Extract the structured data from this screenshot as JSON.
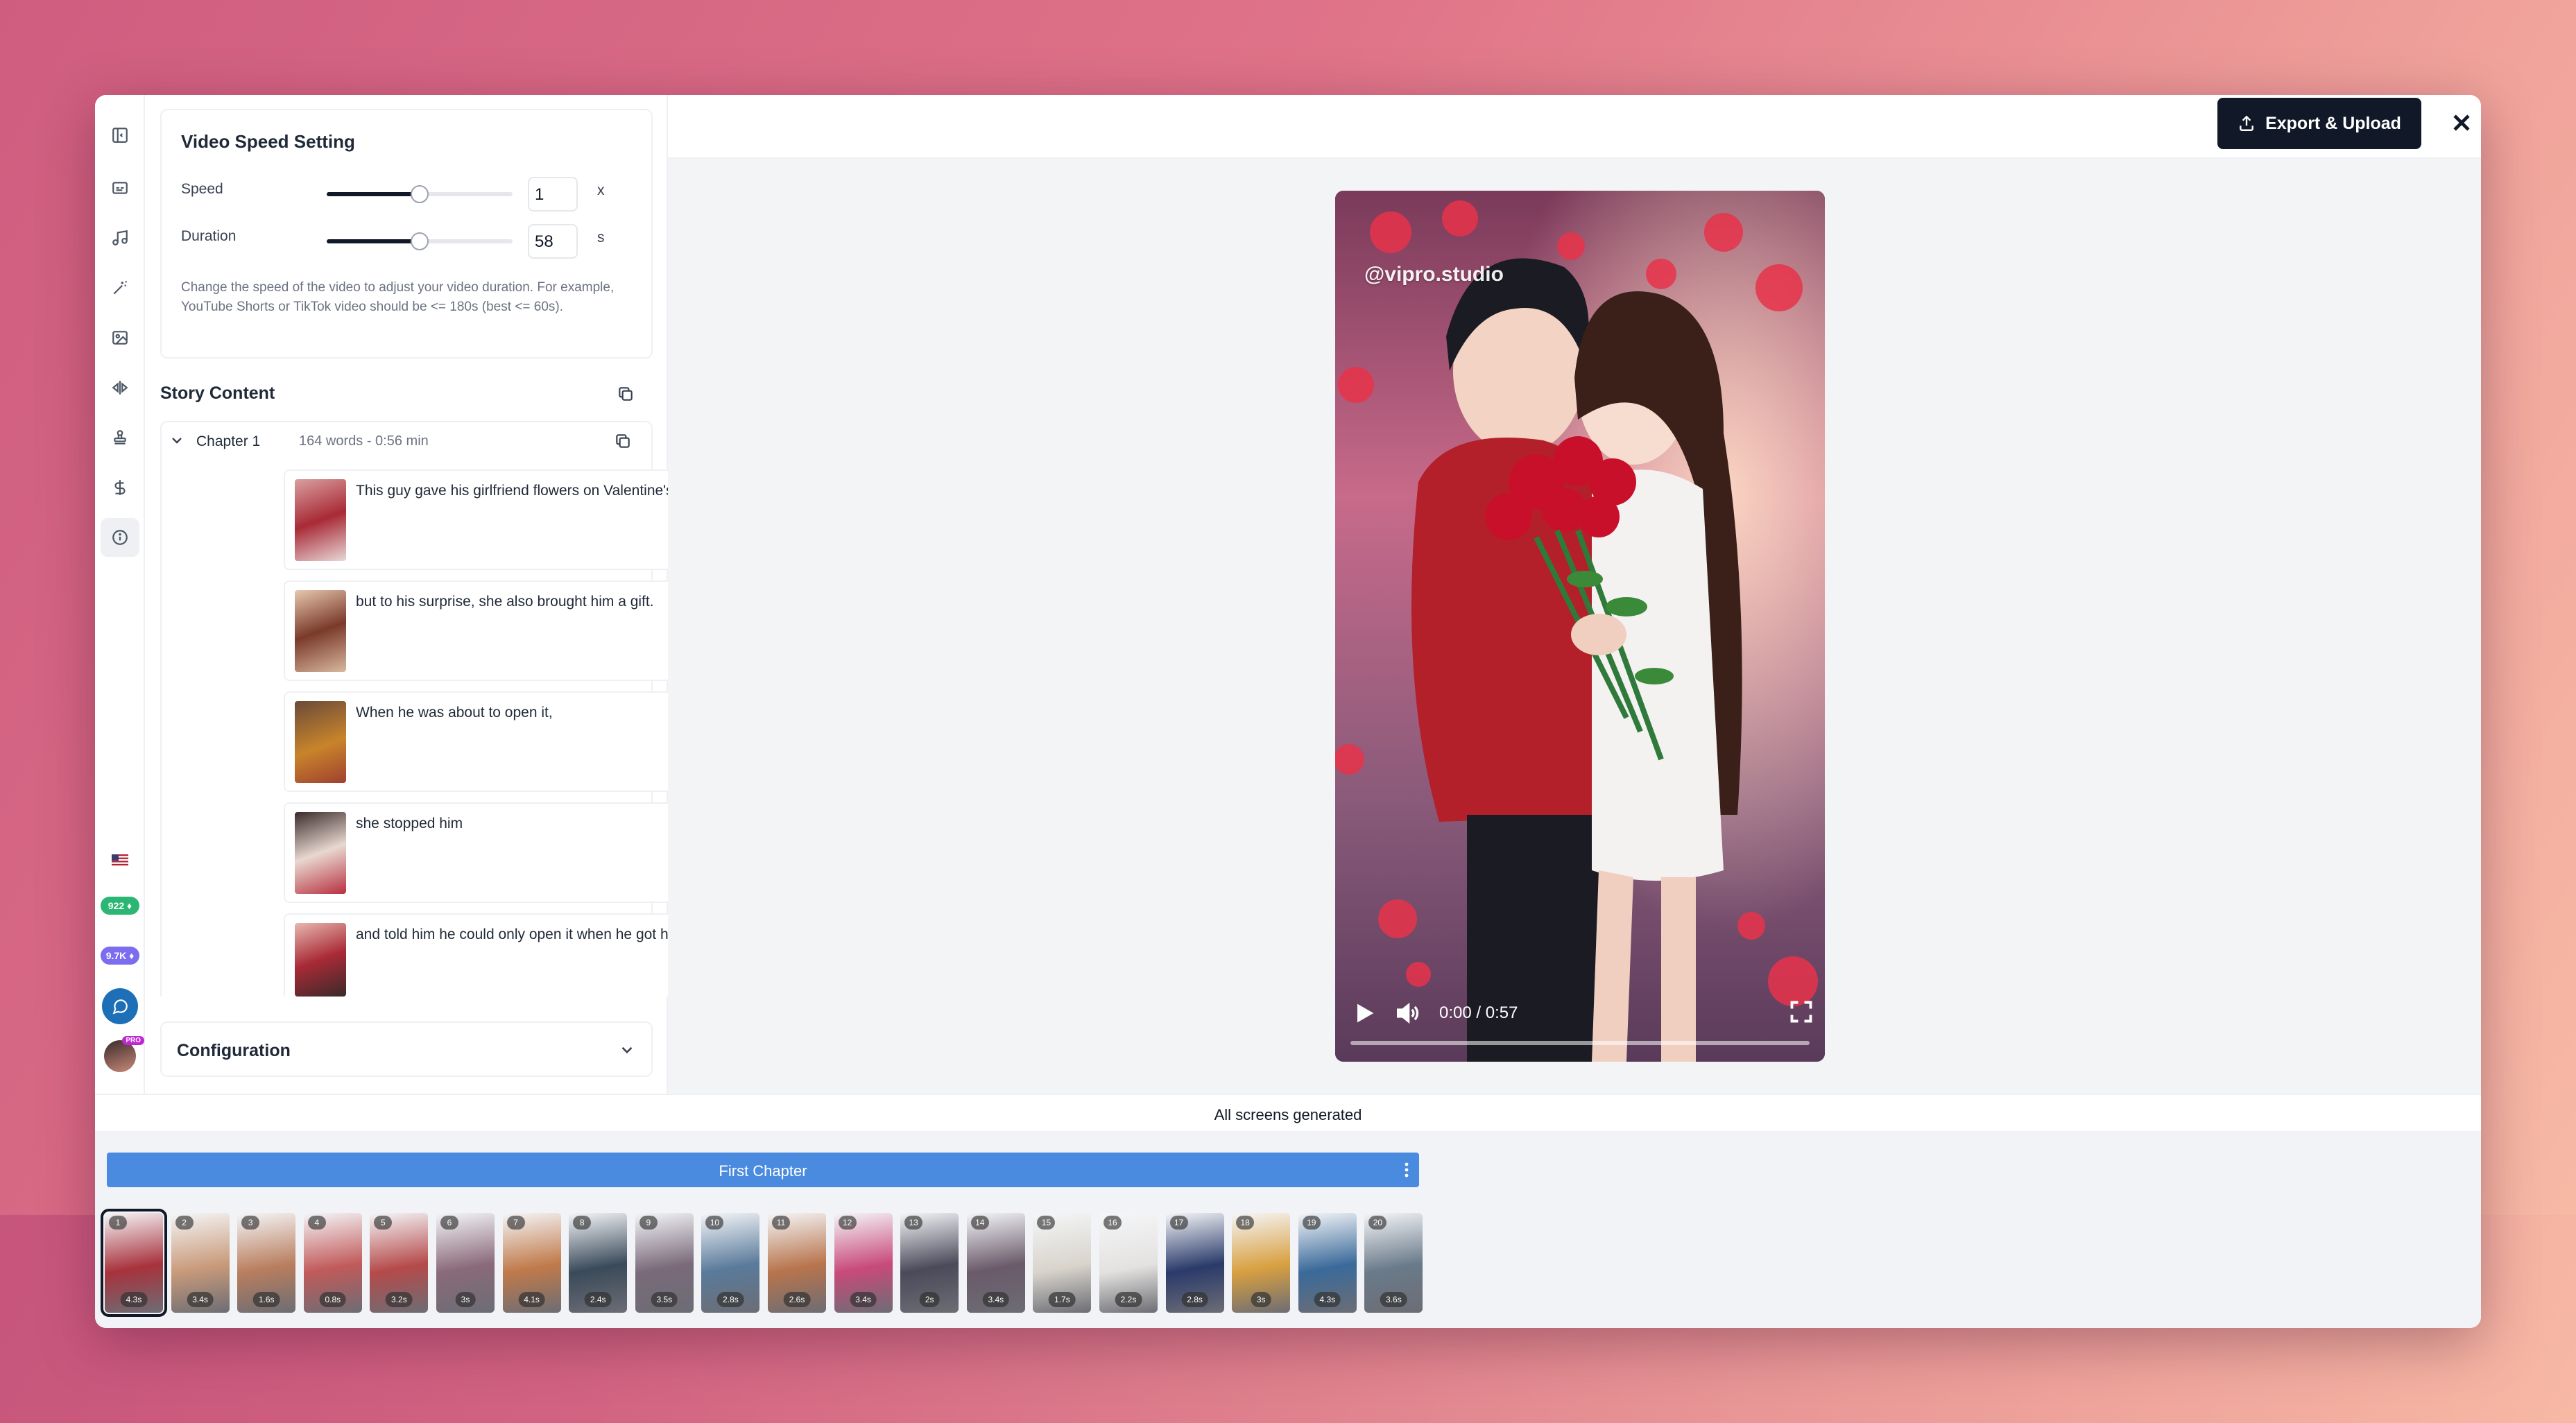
{
  "speed_setting": {
    "title": "Video Speed Setting",
    "speed_label": "Speed",
    "speed_value": "1",
    "speed_unit": "x",
    "speed_slider_fraction": 0.5,
    "duration_label": "Duration",
    "duration_value": "58",
    "duration_unit": "s",
    "duration_slider_fraction": 0.5,
    "help_text": "Change the speed of the video to adjust your video duration. For example, YouTube Shorts or TikTok video should be <= 180s (best <= 60s)."
  },
  "story": {
    "title": "Story Content",
    "chapter_name": "Chapter 1",
    "chapter_meta": "164 words - 0:56 min",
    "scenes": [
      "This guy gave his girlfriend flowers on Valentine's Day,",
      "but to his surprise, she also brought him a gift.",
      "When he was about to open it,",
      "she stopped him",
      "and told him he could only open it when he got home."
    ]
  },
  "configuration_label": "Configuration",
  "header": {
    "export_label": "Export & Upload"
  },
  "video": {
    "watermark": "@vipro.studio",
    "time": "0:00 / 0:57"
  },
  "status_text": "All screens generated",
  "timeline": {
    "chapter_label": "First Chapter",
    "frames": [
      {
        "n": "1",
        "d": "4.3s",
        "c": "#a8323c"
      },
      {
        "n": "2",
        "d": "3.4s",
        "c": "#c99a7a"
      },
      {
        "n": "3",
        "d": "1.6s",
        "c": "#b97e5e"
      },
      {
        "n": "4",
        "d": "0.8s",
        "c": "#c15a5a"
      },
      {
        "n": "5",
        "d": "3.2s",
        "c": "#b54a4a"
      },
      {
        "n": "6",
        "d": "3s",
        "c": "#8a6a7a"
      },
      {
        "n": "7",
        "d": "4.1s",
        "c": "#c07a4a"
      },
      {
        "n": "8",
        "d": "2.4s",
        "c": "#3a4a5a"
      },
      {
        "n": "9",
        "d": "3.5s",
        "c": "#7a6a7a"
      },
      {
        "n": "10",
        "d": "2.8s",
        "c": "#5a7a9a"
      },
      {
        "n": "11",
        "d": "2.6s",
        "c": "#b8744c"
      },
      {
        "n": "12",
        "d": "3.4s",
        "c": "#c84a7a"
      },
      {
        "n": "13",
        "d": "2s",
        "c": "#4a4a5a"
      },
      {
        "n": "14",
        "d": "3.4s",
        "c": "#6a5a6a"
      },
      {
        "n": "15",
        "d": "1.7s",
        "c": "#d8d4cc"
      },
      {
        "n": "16",
        "d": "2.2s",
        "c": "#e4e2e0"
      },
      {
        "n": "17",
        "d": "2.8s",
        "c": "#2a3a6a"
      },
      {
        "n": "18",
        "d": "3s",
        "c": "#d8a040"
      },
      {
        "n": "19",
        "d": "4.3s",
        "c": "#3a6a9a"
      },
      {
        "n": "20",
        "d": "3.6s",
        "c": "#6a7a8a"
      }
    ]
  },
  "rail": {
    "badge_1": "922",
    "badge_2": "9.7K",
    "pro_badge": "PRO",
    "badge_1_color": "#2bb673",
    "badge_2_color": "#7b6cf0"
  },
  "colors": {
    "accent_blue": "#4a8be0",
    "dark": "#111827"
  }
}
